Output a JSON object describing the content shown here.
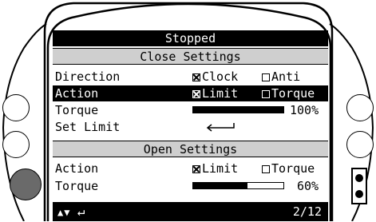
{
  "header": {
    "title": "Stopped"
  },
  "close_section": {
    "heading": "Close Settings",
    "direction": {
      "label": "Direction",
      "options": [
        "Clock",
        "Anti"
      ],
      "checked": [
        true,
        false
      ]
    },
    "action": {
      "label": "Action",
      "options": [
        "Limit",
        "Torque"
      ],
      "checked": [
        true,
        false
      ]
    },
    "torque": {
      "label": "Torque",
      "value_text": "100%",
      "level": 1.0
    },
    "set_limit": {
      "label": "Set Limit",
      "icon": "enter-arrow-icon"
    }
  },
  "open_section": {
    "heading": "Open Settings",
    "action": {
      "label": "Action",
      "options": [
        "Limit",
        "Torque"
      ],
      "checked": [
        true,
        false
      ]
    },
    "torque": {
      "label": "Torque",
      "value_text": "60%",
      "level": 0.6
    }
  },
  "footer": {
    "nav_icons": [
      "up-arrow-icon",
      "down-arrow-icon",
      "enter-icon"
    ],
    "page": "2/12"
  }
}
